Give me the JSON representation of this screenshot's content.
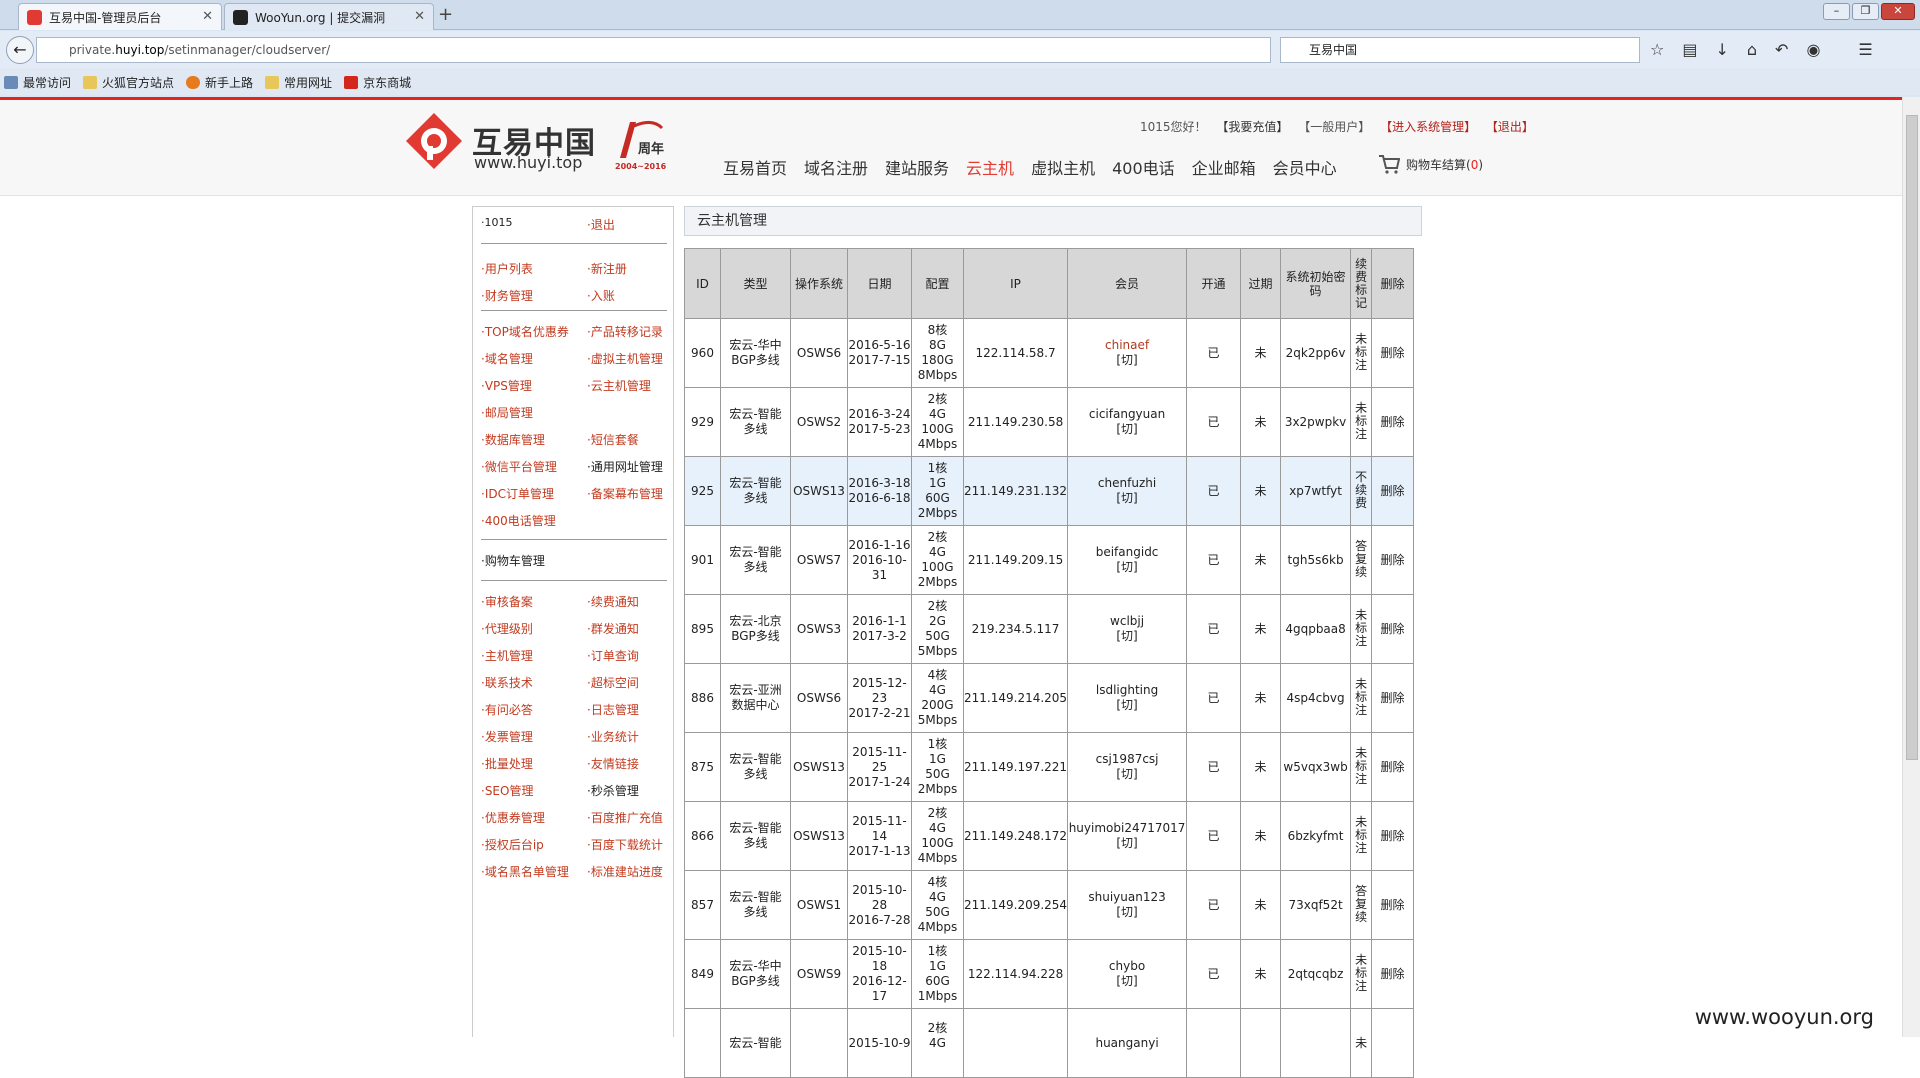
{
  "browser": {
    "tabs": [
      {
        "title": "互易中国-管理员后台",
        "active": true
      },
      {
        "title": "WooYun.org | 提交漏洞",
        "active": false
      }
    ],
    "url_prefix": "private.",
    "url_host": "huyi.top",
    "url_path": "/setinmanager/cloudserver/",
    "search_text": "互易中国",
    "bookmarks": [
      "最常访问",
      "火狐官方站点",
      "新手上路",
      "常用网址",
      "京东商城"
    ]
  },
  "header": {
    "logo_cn": "互易中国",
    "logo_en": "www.huyi.top",
    "anniversary_year": "周年",
    "anniversary_range": "2004~2016",
    "greeting": "1015您好！",
    "recharge": "【我要充值】",
    "user_type": "【一般用户】",
    "sys_admin": "【进入系统管理】",
    "logout": "【退出】",
    "nav": [
      "互易首页",
      "域名注册",
      "建站服务",
      "云主机",
      "虚拟主机",
      "400电话",
      "企业邮箱",
      "会员中心"
    ],
    "nav_active": "云主机",
    "cart_label": "购物车结算(",
    "cart_count": "0",
    "cart_close": ")"
  },
  "sidebar": {
    "user": "·1015",
    "logout": "·退出",
    "group1": [
      "·用户列表",
      "·新注册",
      "·财务管理",
      "·入账"
    ],
    "group2": [
      "·TOP域名优惠券",
      "·产品转移记录",
      "·域名管理",
      "·虚拟主机管理",
      "·VPS管理",
      "·云主机管理",
      "·邮局管理",
      "",
      "·数据库管理",
      "·短信套餐",
      "·微信平台管理",
      "·通用网址管理",
      "·IDC订单管理",
      "·备案幕布管理",
      "·400电话管理",
      ""
    ],
    "cart_mgmt": "·购物车管理",
    "group3": [
      "·审核备案",
      "·续费通知",
      "·代理级别",
      "·群发通知",
      "·主机管理",
      "·订单查询",
      "·联系技术",
      "·超标空间",
      "·有问必答",
      "·日志管理",
      "·发票管理",
      "·业务统计",
      "·批量处理",
      "·友情链接",
      "·SEO管理",
      "·秒杀管理",
      "·优惠券管理",
      "·百度推广充值",
      "·授权后台ip",
      "·百度下载统计",
      "·域名黑名单管理",
      "·标准建站进度"
    ]
  },
  "main": {
    "title": "云主机管理",
    "columns": [
      "ID",
      "类型",
      "操作系统",
      "日期",
      "配置",
      "IP",
      "会员",
      "开通",
      "过期",
      "系统初始密码",
      "续费标记",
      "删除"
    ],
    "rows": [
      {
        "id": "960",
        "type1": "宏云-华中",
        "type2": "BGP多线",
        "os": "OSWS6",
        "d1": "2016-5-16",
        "d2": "2017-7-15",
        "c1": "8核",
        "c2": "8G",
        "c3": "180G",
        "c4": "8Mbps",
        "ip": "122.114.58.7",
        "member": "chinaef",
        "switch": "[切]",
        "open": "已",
        "expired": "未",
        "pwd": "2qk2pp6v",
        "renew": "未标注",
        "del": "删除"
      },
      {
        "id": "929",
        "type1": "宏云-智能",
        "type2": "多线",
        "os": "OSWS2",
        "d1": "2016-3-24",
        "d2": "2017-5-23",
        "c1": "2核",
        "c2": "4G",
        "c3": "100G",
        "c4": "4Mbps",
        "ip": "211.149.230.58",
        "member": "cicifangyuan",
        "switch": "[切]",
        "open": "已",
        "expired": "未",
        "pwd": "3x2pwpkv",
        "renew": "未标注",
        "del": "删除"
      },
      {
        "id": "925",
        "type1": "宏云-智能",
        "type2": "多线",
        "os": "OSWS13",
        "d1": "2016-3-18",
        "d2": "2016-6-18",
        "c1": "1核",
        "c2": "1G",
        "c3": "60G",
        "c4": "2Mbps",
        "ip": "211.149.231.132",
        "member": "chenfuzhi",
        "switch": "[切]",
        "open": "已",
        "expired": "未",
        "pwd": "xp7wtfyt",
        "renew": "不续费",
        "del": "删除"
      },
      {
        "id": "901",
        "type1": "宏云-智能",
        "type2": "多线",
        "os": "OSWS7",
        "d1": "2016-1-16",
        "d2": "2016-10-31",
        "c1": "2核",
        "c2": "4G",
        "c3": "100G",
        "c4": "2Mbps",
        "ip": "211.149.209.15",
        "member": "beifangidc",
        "switch": "[切]",
        "open": "已",
        "expired": "未",
        "pwd": "tgh5s6kb",
        "renew": "答复续",
        "del": "删除"
      },
      {
        "id": "895",
        "type1": "宏云-北京",
        "type2": "BGP多线",
        "os": "OSWS3",
        "d1": "2016-1-1",
        "d2": "2017-3-2",
        "c1": "2核",
        "c2": "2G",
        "c3": "50G",
        "c4": "5Mbps",
        "ip": "219.234.5.117",
        "member": "wclbjj",
        "switch": "[切]",
        "open": "已",
        "expired": "未",
        "pwd": "4gqpbaa8",
        "renew": "未标注",
        "del": "删除"
      },
      {
        "id": "886",
        "type1": "宏云-亚洲",
        "type2": "数据中心",
        "os": "OSWS6",
        "d1": "2015-12-23",
        "d2": "2017-2-21",
        "c1": "4核",
        "c2": "4G",
        "c3": "200G",
        "c4": "5Mbps",
        "ip": "211.149.214.205",
        "member": "lsdlighting",
        "switch": "[切]",
        "open": "已",
        "expired": "未",
        "pwd": "4sp4cbvg",
        "renew": "未标注",
        "del": "删除"
      },
      {
        "id": "875",
        "type1": "宏云-智能",
        "type2": "多线",
        "os": "OSWS13",
        "d1": "2015-11-25",
        "d2": "2017-1-24",
        "c1": "1核",
        "c2": "1G",
        "c3": "50G",
        "c4": "2Mbps",
        "ip": "211.149.197.221",
        "member": "csj1987csj",
        "switch": "[切]",
        "open": "已",
        "expired": "未",
        "pwd": "w5vqx3wb",
        "renew": "未标注",
        "del": "删除"
      },
      {
        "id": "866",
        "type1": "宏云-智能",
        "type2": "多线",
        "os": "OSWS13",
        "d1": "2015-11-14",
        "d2": "2017-1-13",
        "c1": "2核",
        "c2": "4G",
        "c3": "100G",
        "c4": "4Mbps",
        "ip": "211.149.248.172",
        "member": "huyimobi24717017",
        "switch": "[切]",
        "open": "已",
        "expired": "未",
        "pwd": "6bzkyfmt",
        "renew": "未标注",
        "del": "删除"
      },
      {
        "id": "857",
        "type1": "宏云-智能",
        "type2": "多线",
        "os": "OSWS1",
        "d1": "2015-10-28",
        "d2": "2016-7-28",
        "c1": "4核",
        "c2": "4G",
        "c3": "50G",
        "c4": "4Mbps",
        "ip": "211.149.209.254",
        "member": "shuiyuan123",
        "switch": "[切]",
        "open": "已",
        "expired": "未",
        "pwd": "73xqf52t",
        "renew": "答复续",
        "del": "删除"
      },
      {
        "id": "849",
        "type1": "宏云-华中",
        "type2": "BGP多线",
        "os": "OSWS9",
        "d1": "2015-10-18",
        "d2": "2016-12-17",
        "c1": "1核",
        "c2": "1G",
        "c3": "60G",
        "c4": "1Mbps",
        "ip": "122.114.94.228",
        "member": "chybo",
        "switch": "[切]",
        "open": "已",
        "expired": "未",
        "pwd": "2qtqcqbz",
        "renew": "未标注",
        "del": "删除"
      },
      {
        "id": "",
        "type1": "宏云-智能",
        "type2": "",
        "os": "",
        "d1": "2015-10-9",
        "d2": "",
        "c1": "2核",
        "c2": "4G",
        "c3": "",
        "c4": "",
        "ip": "",
        "member": "huanganyi",
        "switch": "",
        "open": "",
        "expired": "",
        "pwd": "",
        "renew": "未",
        "del": ""
      }
    ]
  },
  "watermark": "www.wooyun.org"
}
